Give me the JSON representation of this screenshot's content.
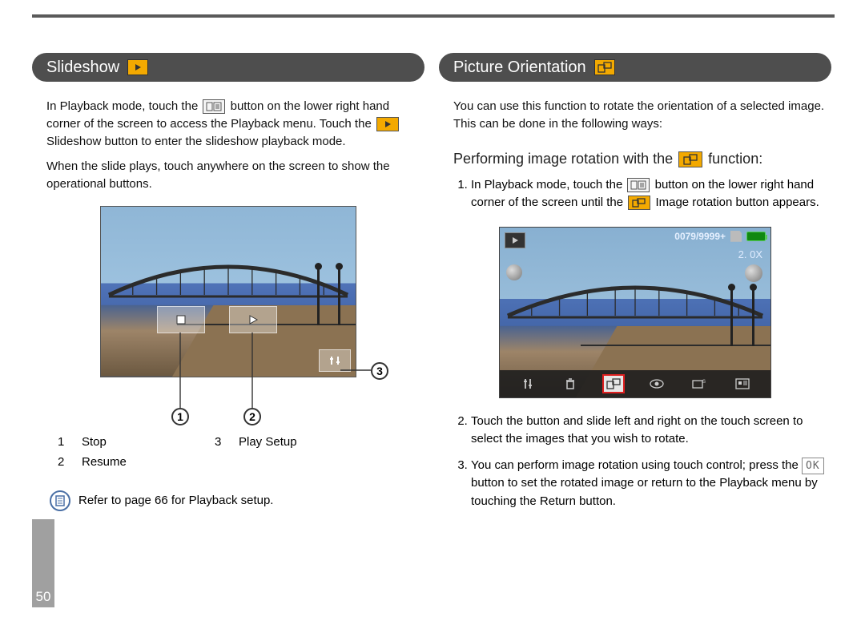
{
  "page_number": "50",
  "left": {
    "heading": "Slideshow",
    "para1a": "In Playback mode, touch the ",
    "para1b": " button on the lower right hand corner of the screen to access the Playback menu. Touch the ",
    "para1c": " Slideshow button to enter the slideshow playback mode.",
    "para2": "When the slide plays, touch anywhere on the screen to show the operational buttons.",
    "legend": {
      "n1": "1",
      "l1": "Stop",
      "n2": "2",
      "l2": "Resume",
      "n3": "3",
      "l3": "Play Setup"
    },
    "note": "Refer to page 66 for Playback setup.",
    "callouts": {
      "c1": "1",
      "c2": "2",
      "c3": "3"
    }
  },
  "right": {
    "heading": "Picture Orientation",
    "intro": "You can use this function to rotate the orientation of a selected image. This can be done in the following ways:",
    "subhead_a": "Performing image rotation with the ",
    "subhead_b": " function:",
    "step1a": "In Playback mode, touch the ",
    "step1b": " button on the lower right hand corner of the screen until the ",
    "step1c": " Image rotation button appears.",
    "step2": "Touch the button and slide left and right on the touch screen to select the images that you wish to rotate.",
    "step3a": "You can perform image rotation using touch control; press the ",
    "step3b": " button to set the rotated image or return to the Playback menu by touching the Return button.",
    "ok_label": "OK",
    "overlay": {
      "counter": "0079/9999+",
      "zoom": "2. 0X"
    }
  }
}
